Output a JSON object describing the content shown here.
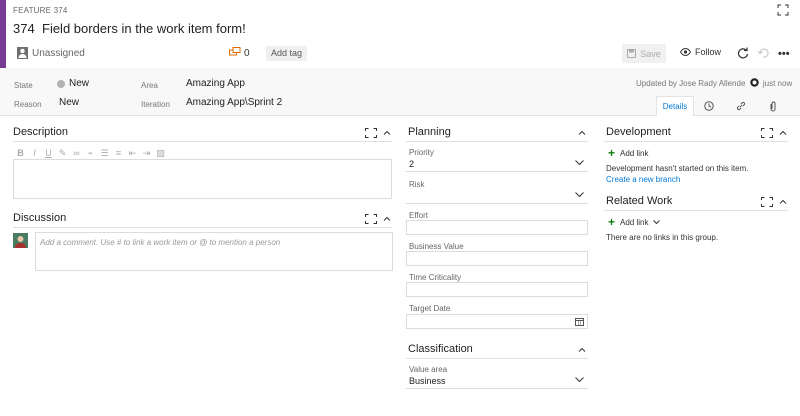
{
  "work_item": {
    "type_label": "FEATURE 374",
    "id": "374",
    "title": "Field borders in the work item form!",
    "assigned": "Unassigned",
    "discussion_count": "0",
    "add_tag_label": "Add tag",
    "accent_color": "#773b93"
  },
  "toolbar": {
    "save_label": "Save",
    "follow_label": "Follow"
  },
  "fields": {
    "state_label": "State",
    "state_value": "New",
    "reason_label": "Reason",
    "reason_value": "New",
    "area_label": "Area",
    "area_value": "Amazing App",
    "iteration_label": "Iteration",
    "iteration_value": "Amazing App\\Sprint 2",
    "updated_text": "Updated by Jose Rady Allende",
    "updated_time": "just now"
  },
  "tabs": {
    "details_label": "Details"
  },
  "description": {
    "title": "Description",
    "toolbar_icons": [
      "bold-icon",
      "italic-icon",
      "underline-icon",
      "highlight-icon",
      "link-icon",
      "unlink-icon",
      "bullet-list-icon",
      "numbered-list-icon",
      "outdent-icon",
      "indent-icon",
      "image-icon"
    ]
  },
  "discussion": {
    "title": "Discussion",
    "placeholder": "Add a comment. Use # to link a work item or @ to mention a person"
  },
  "planning": {
    "title": "Planning",
    "priority_label": "Priority",
    "priority_value": "2",
    "risk_label": "Risk",
    "effort_label": "Effort",
    "business_value_label": "Business Value",
    "time_criticality_label": "Time Criticality",
    "target_date_label": "Target Date"
  },
  "classification": {
    "title": "Classification",
    "value_area_label": "Value area",
    "value_area_value": "Business"
  },
  "development": {
    "title": "Development",
    "add_link_label": "Add link",
    "status_text": "Development hasn't started on this item.",
    "create_branch_label": "Create a new branch"
  },
  "related_work": {
    "title": "Related Work",
    "add_link_label": "Add link",
    "empty_text": "There are no links in this group."
  },
  "colors": {
    "link_blue": "#0078d4",
    "add_green": "#107c10",
    "state_gray": "#b2b2b2"
  }
}
